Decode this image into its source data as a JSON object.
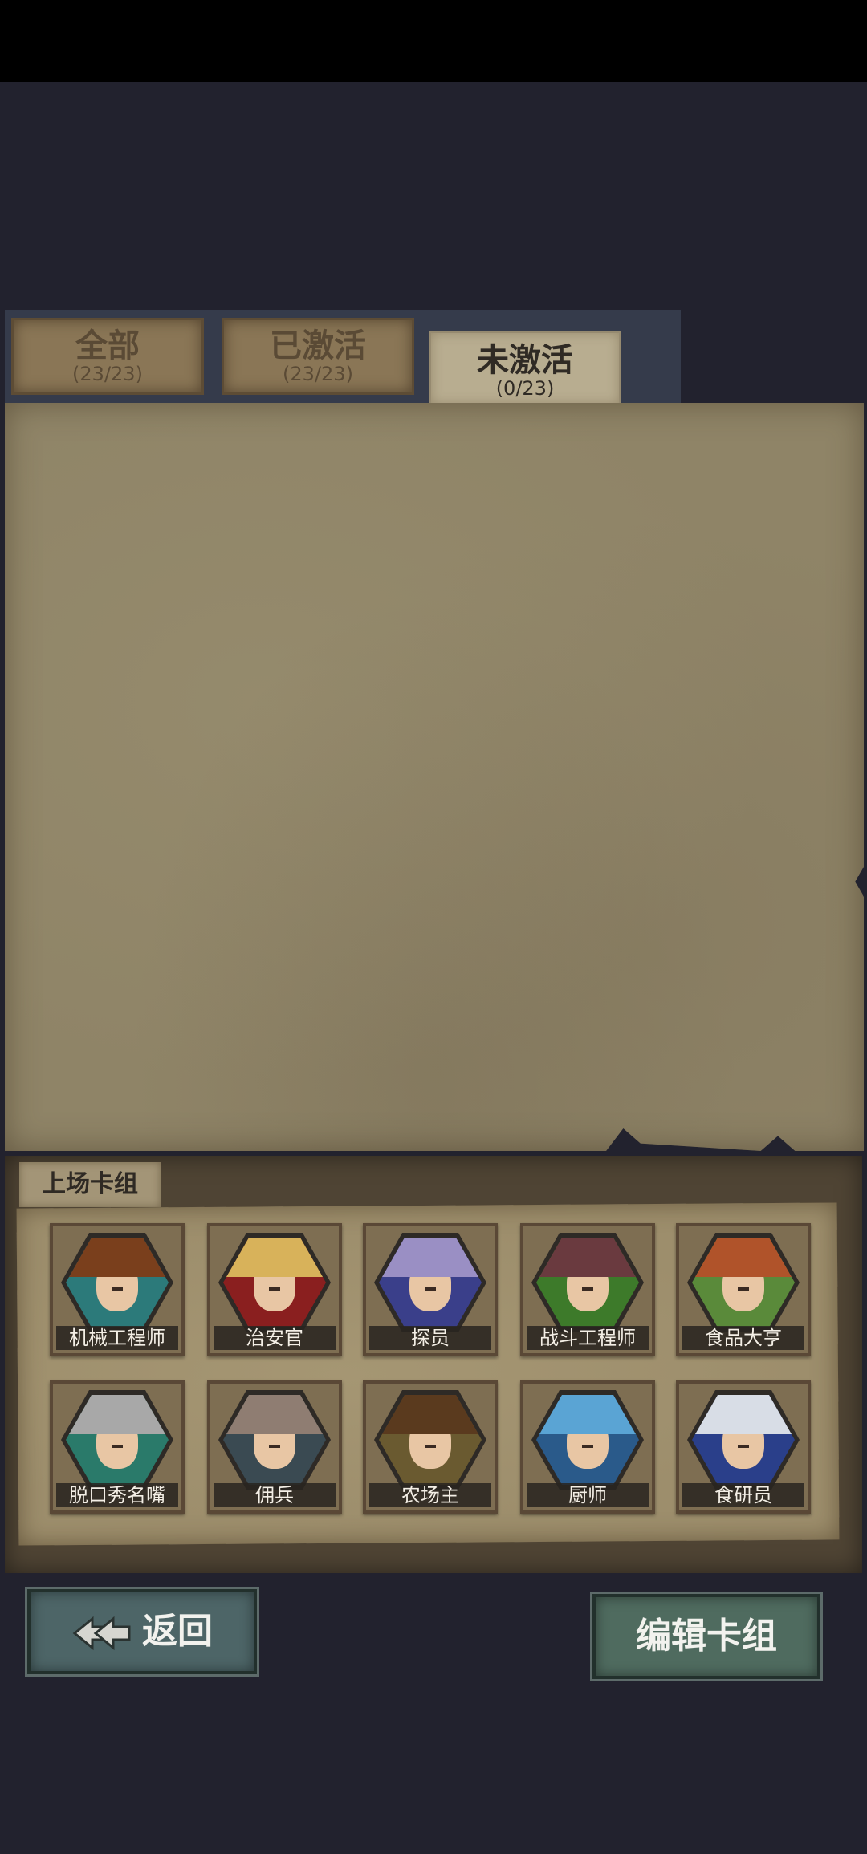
{
  "tabs": [
    {
      "label": "全部",
      "count": "(23/23)"
    },
    {
      "label": "已激活",
      "count": "(23/23)"
    },
    {
      "label": "未激活",
      "count": "(0/23)"
    }
  ],
  "deck": {
    "label": "上场卡组",
    "characters": [
      {
        "name": "机械工程师",
        "hair": "#7a3f1c",
        "bg": "#2c7a7a"
      },
      {
        "name": "治安官",
        "hair": "#d8b25a",
        "bg": "#8a1f1f"
      },
      {
        "name": "探员",
        "hair": "#9a8fc4",
        "bg": "#3a3f8a"
      },
      {
        "name": "战斗工程师",
        "hair": "#6a3a3f",
        "bg": "#3d7a2a"
      },
      {
        "name": "食品大亨",
        "hair": "#b0532a",
        "bg": "#5a8a3a"
      },
      {
        "name": "脱口秀名嘴",
        "hair": "#a8a8a8",
        "bg": "#2a7a6a"
      },
      {
        "name": "佣兵",
        "hair": "#8f7d72",
        "bg": "#3a4a52"
      },
      {
        "name": "农场主",
        "hair": "#5a3a1e",
        "bg": "#6a5a30"
      },
      {
        "name": "厨师",
        "hair": "#5aa4d4",
        "bg": "#2a5a8a"
      },
      {
        "name": "食研员",
        "hair": "#d8dde6",
        "bg": "#2a3f8a"
      }
    ]
  },
  "buttons": {
    "back": "返回",
    "edit": "编辑卡组"
  }
}
